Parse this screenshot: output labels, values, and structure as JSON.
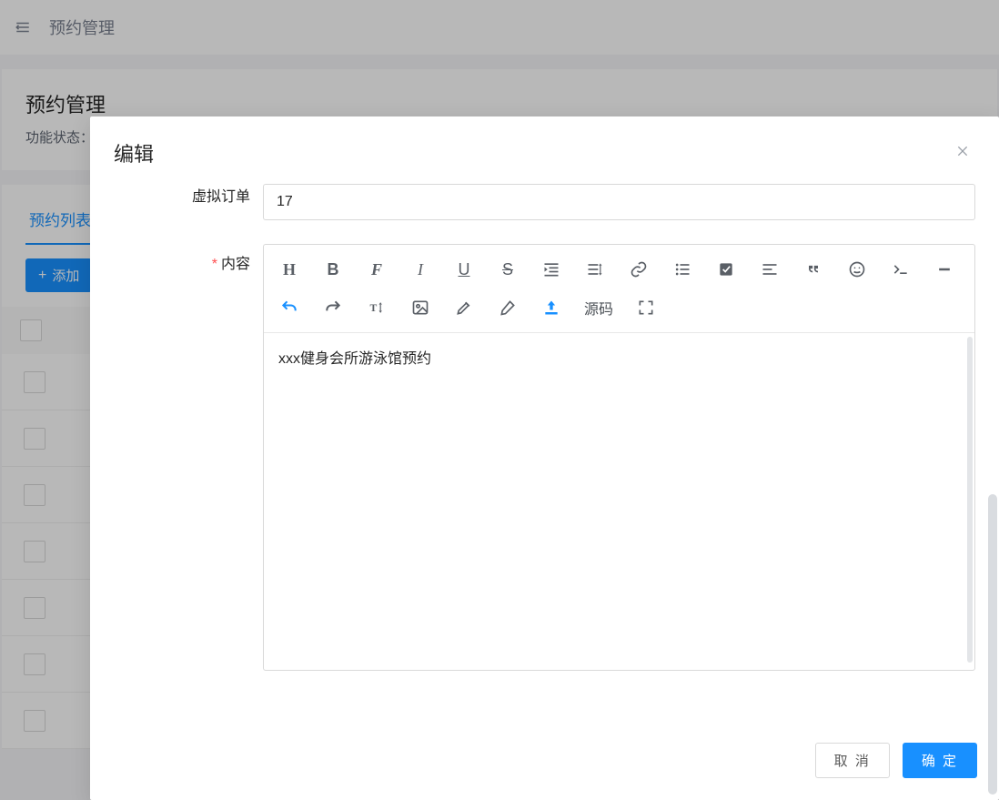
{
  "header": {
    "title": "预约管理"
  },
  "page": {
    "title": "预约管理",
    "status_label": "功能状态："
  },
  "tabs": {
    "items": [
      {
        "label": "预约列表"
      }
    ]
  },
  "actions": {
    "add_label": "添加"
  },
  "modal": {
    "title": "编辑",
    "fields": {
      "virtual_order": {
        "label": "虚拟订单",
        "value": "17"
      },
      "content": {
        "label": "内容",
        "required": true
      }
    },
    "editor_toolbar": {
      "source_label": "源码"
    },
    "editor_content": "xxx健身会所游泳馆预约",
    "footer": {
      "cancel": "取 消",
      "ok": "确 定"
    }
  },
  "colors": {
    "primary": "#1890ff",
    "danger": "#ff4d4f"
  }
}
